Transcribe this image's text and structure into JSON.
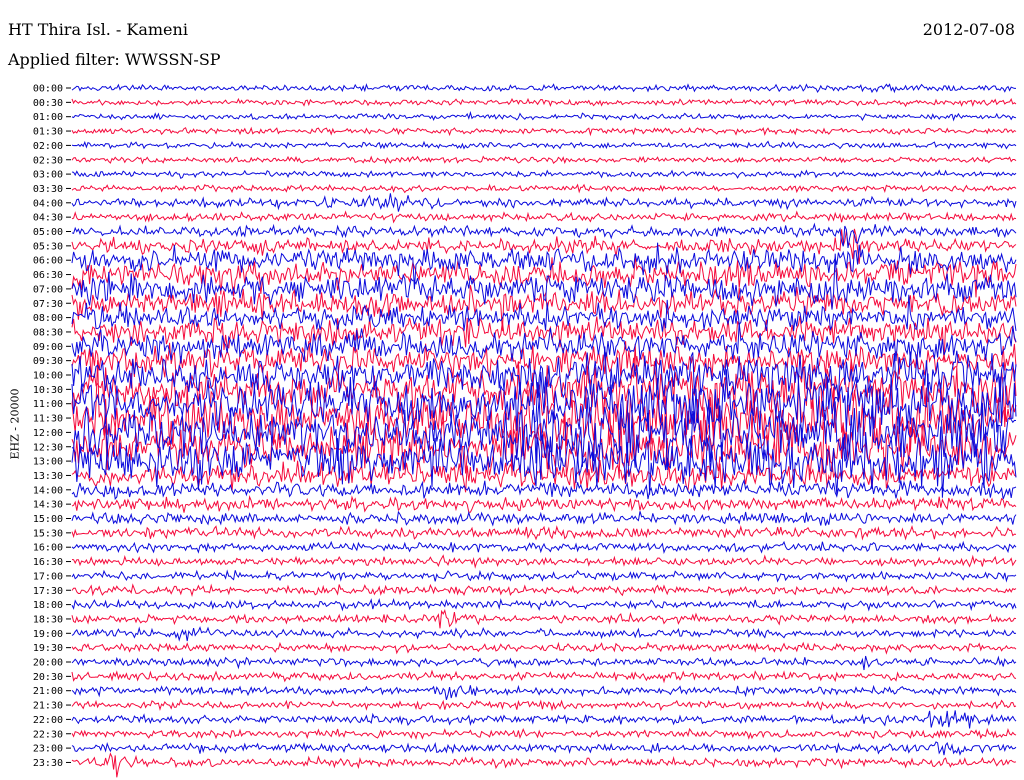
{
  "header": {
    "station": "HT Thira Isl. - Kameni",
    "filter": "Applied filter: WWSSN-SP",
    "date": "2012-07-08"
  },
  "chart_data": {
    "type": "line",
    "title": "HT Thira Isl. - Kameni",
    "subtitle": "Applied filter: WWSSN-SP",
    "date": "2012-07-08",
    "ylabel": "EHZ - 20000",
    "row_interval_minutes": 30,
    "row_labels": [
      "00:00",
      "00:30",
      "01:00",
      "01:30",
      "02:00",
      "02:30",
      "03:00",
      "03:30",
      "04:00",
      "04:30",
      "05:00",
      "05:30",
      "06:00",
      "06:30",
      "07:00",
      "07:30",
      "08:00",
      "08:30",
      "09:00",
      "09:30",
      "10:00",
      "10:30",
      "11:00",
      "11:30",
      "12:00",
      "12:30",
      "13:00",
      "13:30",
      "14:00",
      "14:30",
      "15:00",
      "15:30",
      "16:00",
      "16:30",
      "17:00",
      "17:30",
      "18:00",
      "18:30",
      "19:00",
      "19:30",
      "20:00",
      "20:30",
      "21:00",
      "21:30",
      "22:00",
      "22:30",
      "23:00",
      "23:30"
    ],
    "series_colors": [
      "#0a0adc",
      "#f50a3c"
    ],
    "grid": false,
    "legend": "none"
  }
}
